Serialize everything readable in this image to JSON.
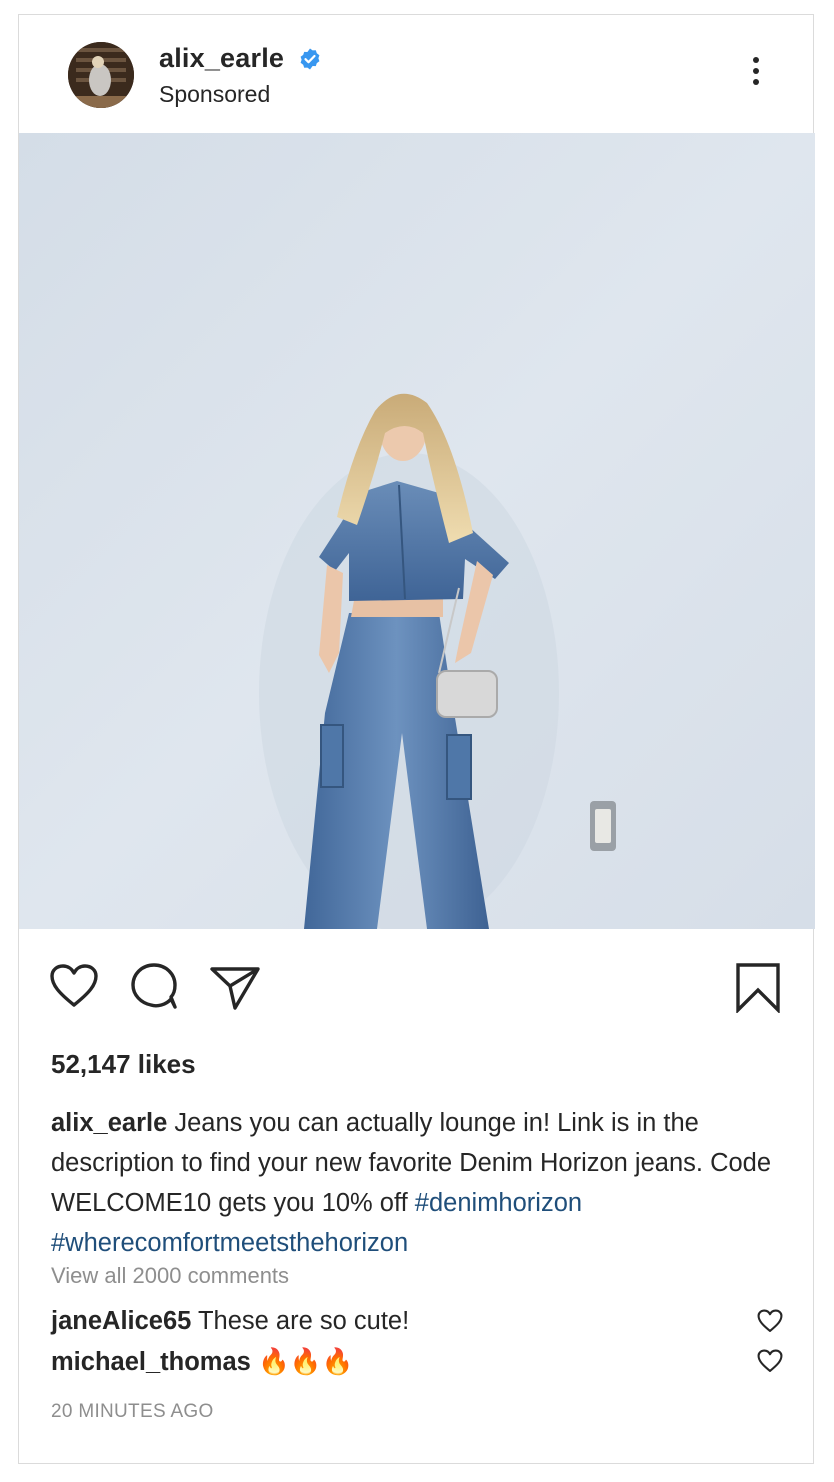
{
  "post": {
    "author": "alix_earle",
    "sponsored_label": "Sponsored",
    "verified": true,
    "likes": "52,147 likes",
    "caption": {
      "username": "alix_earle",
      "text": "Jeans you can actually lounge in! Link is in the description to find your new favorite Denim Horizon jeans. Code WELCOME10 gets you 10% off",
      "hashtags": [
        "#denimhorizon",
        "#wherecomfortmeetsthehorizon"
      ]
    },
    "view_all_comments": "View all 2000 comments",
    "comments": [
      {
        "username": "janeAlice65",
        "text": "These are so cute!"
      },
      {
        "username": "michael_thomas",
        "text": "🔥🔥🔥"
      }
    ],
    "timestamp": "20 MINUTES AGO"
  },
  "icons": {
    "verified": "verified-badge-icon",
    "more": "more-options-icon",
    "like": "heart-icon",
    "comment": "comment-bubble-icon",
    "share": "paper-plane-icon",
    "save": "bookmark-icon"
  },
  "colors": {
    "verified_blue": "#3897f0",
    "hashtag": "#1f4e7a",
    "muted_text": "#8e8e8e",
    "border": "#dbdbdb"
  }
}
